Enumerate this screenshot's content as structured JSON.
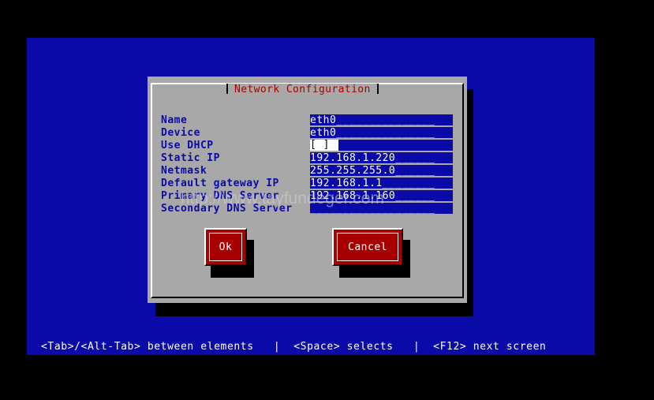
{
  "dialog": {
    "title": "Network Configuration",
    "labels": {
      "name": "Name",
      "device": "Device",
      "use_dhcp": "Use DHCP",
      "static_ip": "Static IP",
      "netmask": "Netmask",
      "gateway": "Default gateway IP",
      "primary_dns": "Primary DNS Server",
      "secondary_dns": "Secondary DNS Server"
    },
    "values": {
      "name": "eth0_______________",
      "device": "eth0_______________",
      "use_dhcp": "[ ]",
      "static_ip": "192.168.1.220______",
      "netmask": "255.255.255.0______",
      "gateway": "192.168.1.1________",
      "primary_dns": "192.168.1.160______",
      "secondary_dns": "___________________"
    },
    "buttons": {
      "ok": "Ok",
      "cancel": "Cancel"
    }
  },
  "help_bar": "<Tab>/<Alt-Tab> between elements   |  <Space> selects   |  <F12> next screen",
  "watermark": "http://www.tayfundeger.com",
  "colors": {
    "screen_bg": "#0a0aa8",
    "dialog_bg": "#a8a8a8",
    "title_text": "#a80000",
    "button_bg": "#a80000"
  }
}
